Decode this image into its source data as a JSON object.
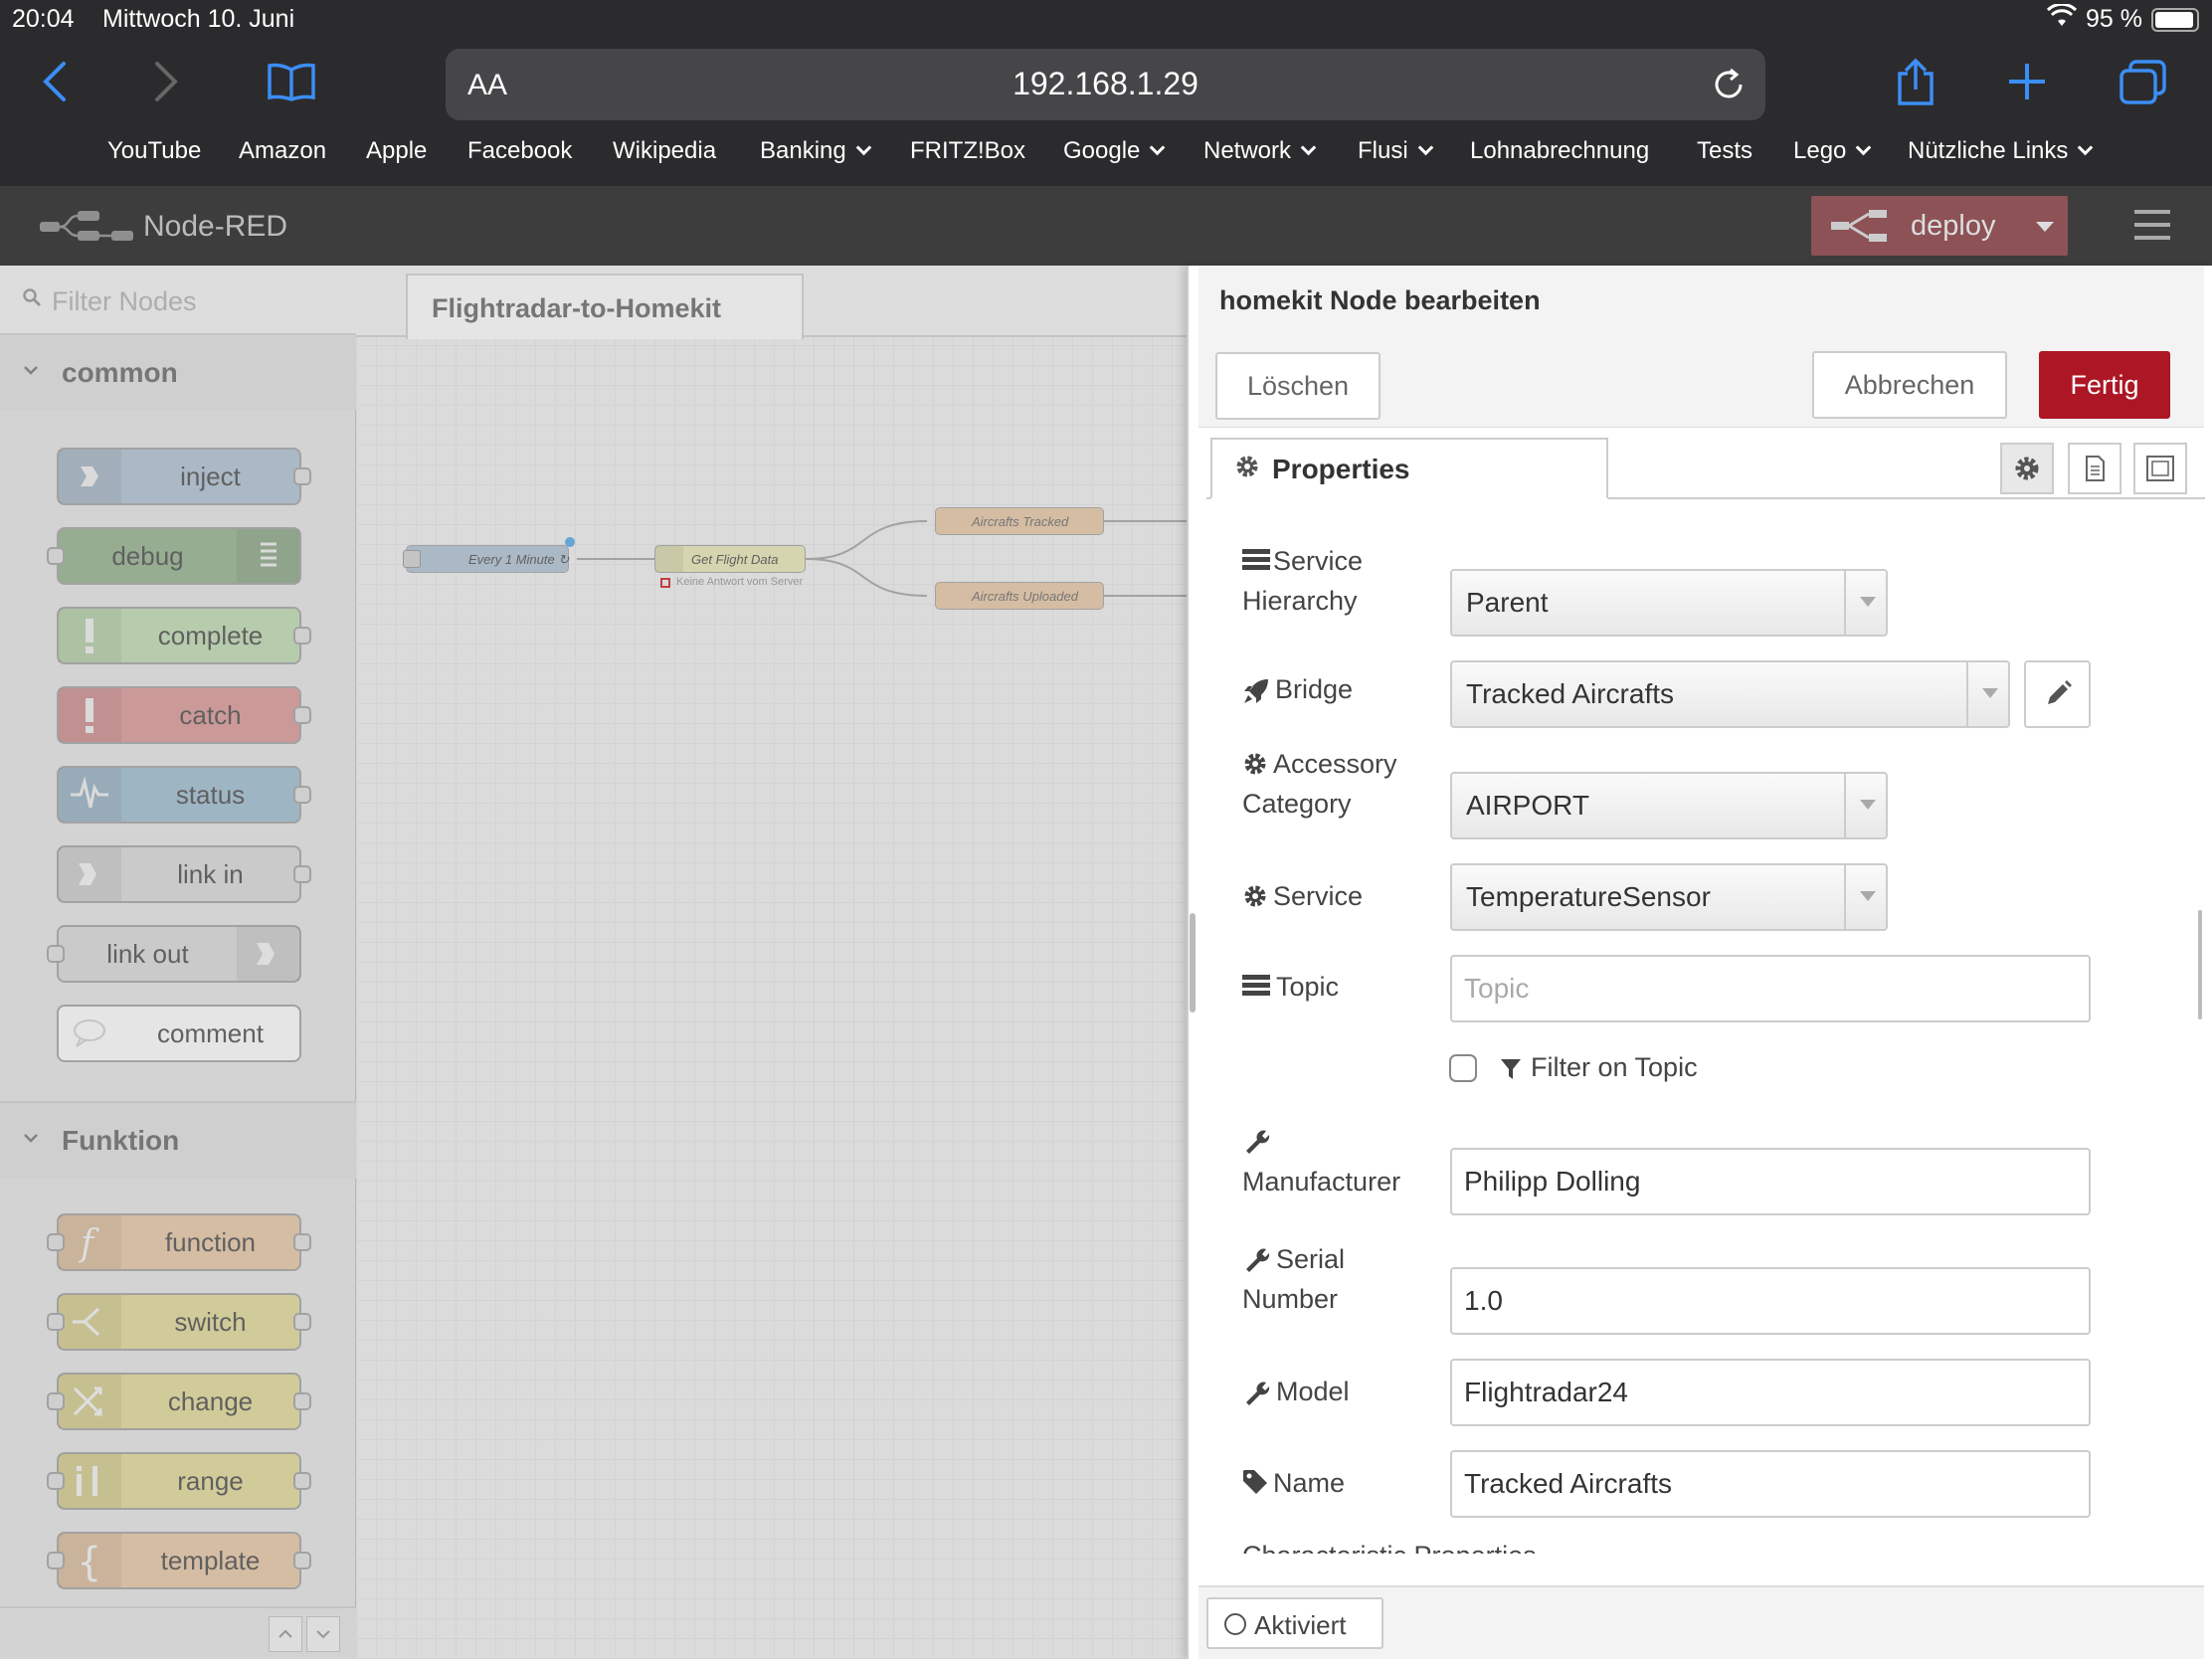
{
  "status": {
    "time": "20:04",
    "date": "Mittwoch 10. Juni",
    "battery": "95 %"
  },
  "safari": {
    "url": "192.168.1.29",
    "text_size": "AA",
    "bookmarks": [
      "YouTube",
      "Amazon",
      "Apple",
      "Facebook",
      "Wikipedia",
      "Banking",
      "FRITZ!Box",
      "Google",
      "Network",
      "Flusi",
      "Lohnabrechnung",
      "Tests",
      "Lego",
      "Nützliche Links"
    ]
  },
  "header": {
    "title": "Node-RED",
    "deploy": "deploy"
  },
  "palette": {
    "filter_placeholder": "Filter Nodes",
    "cat_common": "common",
    "cat_funktion": "Funktion",
    "common_nodes": [
      "inject",
      "debug",
      "complete",
      "catch",
      "status",
      "link in",
      "link out",
      "comment"
    ],
    "funktion_nodes": [
      "function",
      "switch",
      "change",
      "range",
      "template"
    ]
  },
  "workspace": {
    "tab": "Flightradar-to-Homekit",
    "nodes": {
      "inject": "Every 1 Minute ↻",
      "http": "Get Flight Data",
      "http_status": "Keine Antwort vom Server",
      "fn1": "Aircrafts Tracked",
      "fn2": "Aircrafts Uploaded"
    }
  },
  "tray": {
    "title": "homekit Node bearbeiten",
    "delete": "Löschen",
    "cancel": "Abbrechen",
    "done": "Fertig",
    "tab": "Properties",
    "labels": {
      "hierarchy_1": "Service",
      "hierarchy_2": "Hierarchy",
      "bridge": "Bridge",
      "category_1": "Accessory",
      "category_2": "Category",
      "service": "Service",
      "topic": "Topic",
      "filter": "Filter on Topic",
      "manufacturer": "Manufacturer",
      "serial_1": "Serial",
      "serial_2": "Number",
      "model": "Model",
      "name": "Name",
      "characteristic": "Characteristic Properties"
    },
    "values": {
      "hierarchy": "Parent",
      "bridge": "Tracked Aircrafts",
      "category": "AIRPORT",
      "service": "TemperatureSensor",
      "topic_placeholder": "Topic",
      "manufacturer": "Philipp Dolling",
      "serial": "1.0",
      "model": "Flightradar24",
      "name": "Tracked Aircrafts"
    },
    "enabled": "Aktiviert"
  }
}
